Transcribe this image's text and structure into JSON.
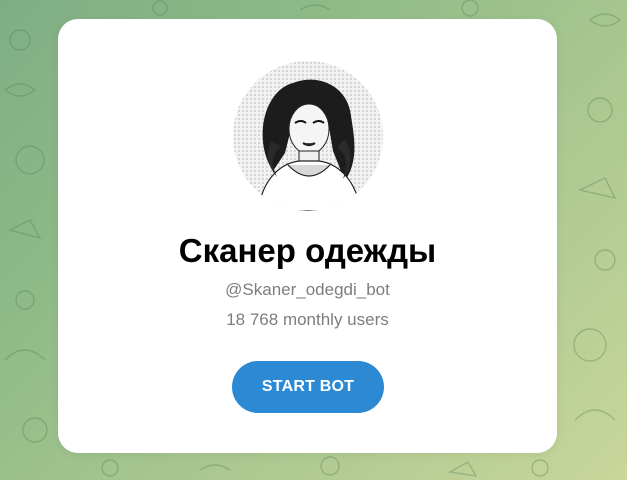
{
  "bot": {
    "name": "Сканер одежды",
    "username": "@Skaner_odegdi_bot",
    "monthly_users": "18 768 monthly users",
    "start_label": "START BOT"
  },
  "colors": {
    "button": "#2c8ad4",
    "card": "#ffffff",
    "muted_text": "#7d7d7d"
  }
}
